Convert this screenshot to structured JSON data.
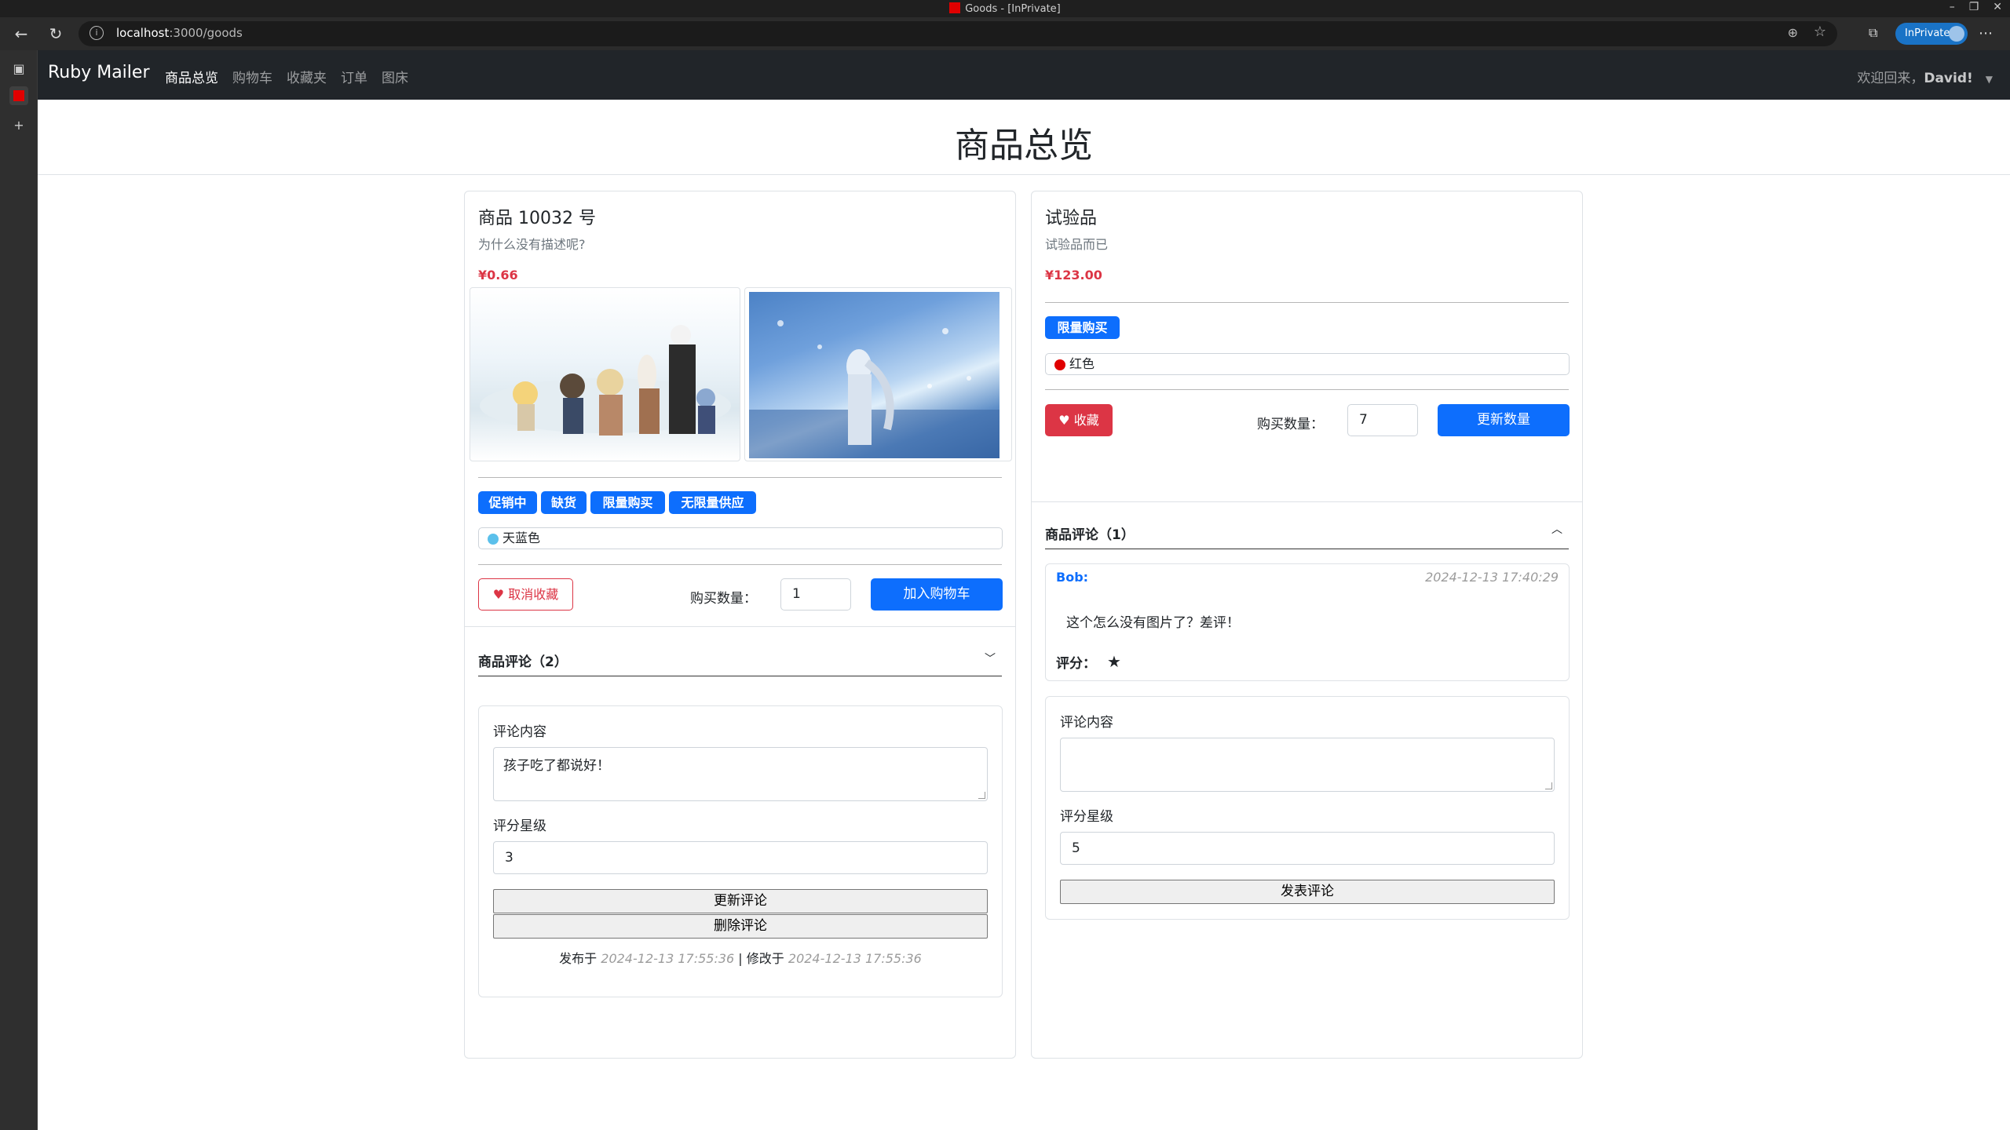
{
  "browser": {
    "window_title": "Goods - [InPrivate]",
    "url_host": "localhost",
    "url_path": ":3000/goods",
    "inprivate_label": "InPrivate"
  },
  "navbar": {
    "brand": "Ruby Mailer",
    "links": [
      "商品总览",
      "购物车",
      "收藏夹",
      "订单",
      "图床"
    ],
    "welcome_prefix": "欢迎回来，",
    "welcome_user": "David!"
  },
  "page_title": "商品总览",
  "goods": [
    {
      "name": "商品 10032 号",
      "description": "为什么没有描述呢?",
      "price": "¥0.66",
      "tags": [
        "促销中",
        "缺货",
        "限量购买",
        "无限量供应"
      ],
      "color_option": "天蓝色",
      "color_hex": "#5bc0eb",
      "favorite_button": "取消收藏",
      "qty_label": "购买数量：",
      "qty_value": "1",
      "cart_button": "加入购物车",
      "reviews_title": "商品评论（2）",
      "form": {
        "content_label": "评论内容",
        "content_value": "孩子吃了都说好！",
        "score_label": "评分星级",
        "score_value": "3",
        "update_button": "更新评论",
        "delete_button": "删除评论",
        "posted_label": "发布于",
        "posted_time": "2024-12-13 17:55:36",
        "separator": "|",
        "modified_label": "修改于",
        "modified_time": "2024-12-13 17:55:36"
      }
    },
    {
      "name": "试验品",
      "description": "试验品而已",
      "price": "¥123.00",
      "tags": [
        "限量购买"
      ],
      "color_option": "红色",
      "color_hex": "#e00000",
      "favorite_button": "收藏",
      "qty_label": "购买数量：",
      "qty_value": "7",
      "cart_button": "更新数量",
      "reviews_title": "商品评论（1）",
      "comment": {
        "author": "Bob:",
        "time": "2024-12-13 17:40:29",
        "text": "这个怎么没有图片了？差评！",
        "score_label": "评分：",
        "stars": 1
      },
      "form": {
        "content_label": "评论内容",
        "content_value": "",
        "score_label": "评分星级",
        "score_value": "5",
        "submit_button": "发表评论"
      }
    }
  ]
}
